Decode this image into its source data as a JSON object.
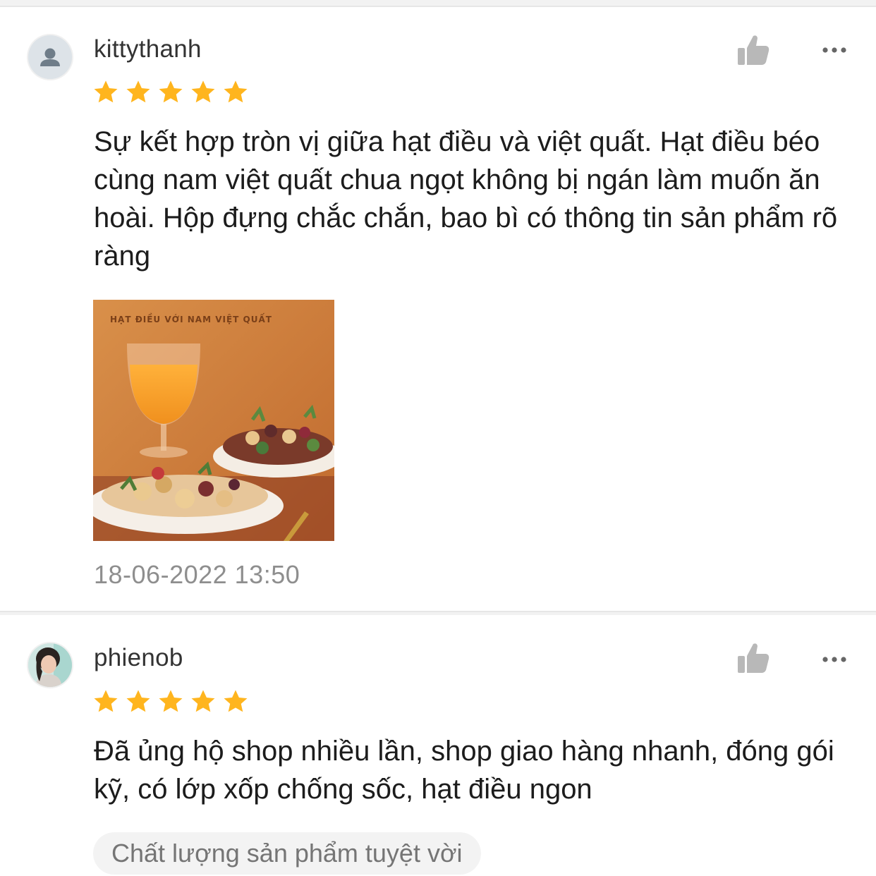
{
  "reviews": [
    {
      "username": "kittythanh",
      "rating": 5,
      "comment": "Sự kết hợp tròn vị giữa hạt điều và việt quất. Hạt điều béo cùng nam việt quất chua ngọt không bị ngán làm muốn ăn hoài. Hộp đựng chắc chắn, bao bì có thông tin sản phẩm rõ ràng",
      "photo_title": "HẠT ĐIỀU VỚI NAM VIỆT QUẤT",
      "timestamp": "18-06-2022 13:50",
      "avatar_icon": "default-user-icon"
    },
    {
      "username": "phienob",
      "rating": 5,
      "comment": "Đã ủng hộ shop nhiều lần, shop giao hàng nhanh, đóng gói kỹ, có lớp xốp chống sốc, hạt điều ngon",
      "tag": "Chất lượng sản phẩm tuyệt vời",
      "avatar_icon": "user-photo"
    }
  ],
  "icons": {
    "like": "thumbs-up-icon",
    "more": "more-options-icon",
    "star": "star-icon"
  },
  "colors": {
    "star": "#FFB51E",
    "icon_gray": "#b8b8b8",
    "timestamp": "#8e8e8e",
    "divider": "#f2f2f2"
  }
}
